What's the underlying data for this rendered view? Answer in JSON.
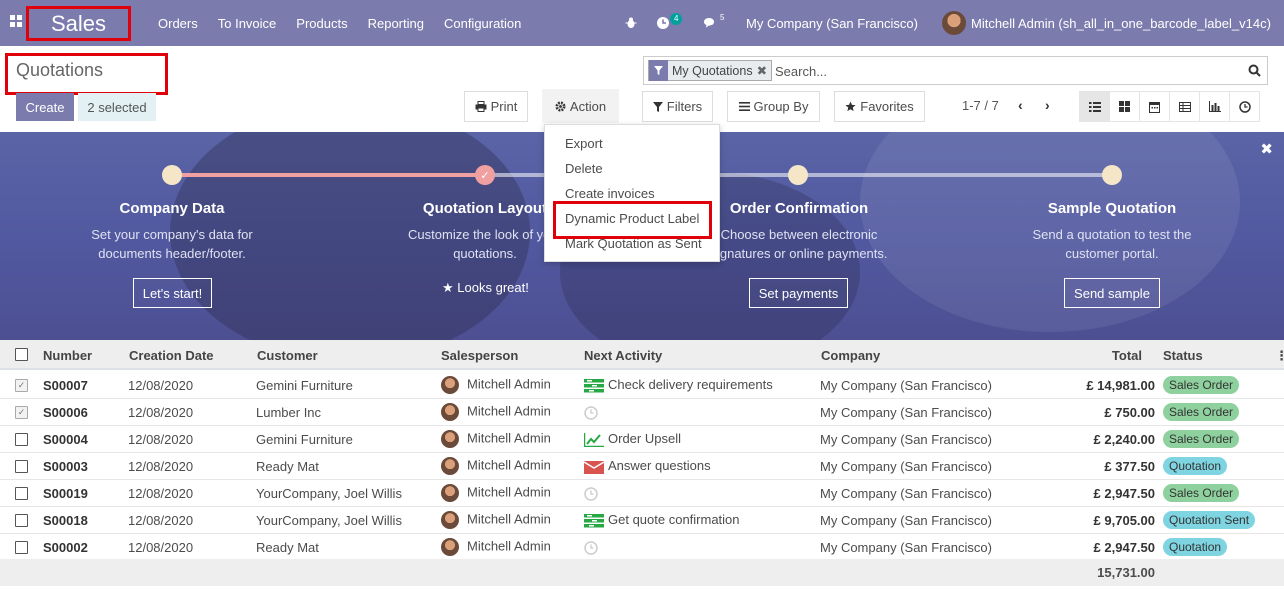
{
  "navbar": {
    "brand": "Sales",
    "menu": [
      "Orders",
      "To Invoice",
      "Products",
      "Reporting",
      "Configuration"
    ],
    "activity_count": "4",
    "message_count": "5",
    "company": "My Company (San Francisco)",
    "user": "Mitchell Admin (sh_all_in_one_barcode_label_v14c)"
  },
  "control": {
    "breadcrumb": "Quotations",
    "create_label": "Create",
    "selected_label": "2 selected",
    "print_label": "Print",
    "action_label": "Action",
    "filters_label": "Filters",
    "groupby_label": "Group By",
    "favorites_label": "Favorites",
    "pager": "1-7 / 7",
    "search_facet": "My Quotations",
    "search_placeholder": "Search..."
  },
  "action_menu": {
    "items": [
      "Export",
      "Delete",
      "Create invoices",
      "Dynamic Product Label",
      "Mark Quotation as Sent"
    ]
  },
  "banner": {
    "steps": [
      {
        "title": "Company Data",
        "desc1": "Set your company's data for",
        "desc2": "documents header/footer.",
        "button": "Let's start!"
      },
      {
        "title": "Quotation Layout",
        "desc1": "Customize the look of your",
        "desc2": "quotations.",
        "button": "Looks great!"
      },
      {
        "title": "Order Confirmation",
        "desc1": "Choose between electronic",
        "desc2": "signatures or online payments.",
        "button": "Set payments"
      },
      {
        "title": "Sample Quotation",
        "desc1": "Send a quotation to test the",
        "desc2": "customer portal.",
        "button": "Send sample"
      }
    ]
  },
  "table": {
    "columns": [
      "Number",
      "Creation Date",
      "Customer",
      "Salesperson",
      "Next Activity",
      "Company",
      "Total",
      "Status"
    ],
    "rows": [
      {
        "number": "S00007",
        "date": "12/08/2020",
        "customer": "Gemini Furniture",
        "salesperson": "Mitchell Admin",
        "activity": "Check delivery requirements",
        "activity_icon": "task-icon",
        "company": "My Company (San Francisco)",
        "total": "£ 14,981.00",
        "status": "Sales Order",
        "status_kind": "so",
        "checked": true
      },
      {
        "number": "S00006",
        "date": "12/08/2020",
        "customer": "Lumber Inc",
        "salesperson": "Mitchell Admin",
        "activity": "",
        "activity_icon": "clock-icon",
        "company": "My Company (San Francisco)",
        "total": "£ 750.00",
        "status": "Sales Order",
        "status_kind": "so",
        "checked": true
      },
      {
        "number": "S00004",
        "date": "12/08/2020",
        "customer": "Gemini Furniture",
        "salesperson": "Mitchell Admin",
        "activity": "Order Upsell",
        "activity_icon": "chart-icon",
        "company": "My Company (San Francisco)",
        "total": "£ 2,240.00",
        "status": "Sales Order",
        "status_kind": "so",
        "checked": false
      },
      {
        "number": "S00003",
        "date": "12/08/2020",
        "customer": "Ready Mat",
        "salesperson": "Mitchell Admin",
        "activity": "Answer questions",
        "activity_icon": "envelope-icon",
        "company": "My Company (San Francisco)",
        "total": "£ 377.50",
        "status": "Quotation",
        "status_kind": "q",
        "checked": false
      },
      {
        "number": "S00019",
        "date": "12/08/2020",
        "customer": "YourCompany, Joel Willis",
        "salesperson": "Mitchell Admin",
        "activity": "",
        "activity_icon": "clock-icon",
        "company": "My Company (San Francisco)",
        "total": "£ 2,947.50",
        "status": "Sales Order",
        "status_kind": "so",
        "checked": false
      },
      {
        "number": "S00018",
        "date": "12/08/2020",
        "customer": "YourCompany, Joel Willis",
        "salesperson": "Mitchell Admin",
        "activity": "Get quote confirmation",
        "activity_icon": "task-icon",
        "company": "My Company (San Francisco)",
        "total": "£ 9,705.00",
        "status": "Quotation Sent",
        "status_kind": "q",
        "checked": false
      },
      {
        "number": "S00002",
        "date": "12/08/2020",
        "customer": "Ready Mat",
        "salesperson": "Mitchell Admin",
        "activity": "",
        "activity_icon": "clock-icon",
        "company": "My Company (San Francisco)",
        "total": "£ 2,947.50",
        "status": "Quotation",
        "status_kind": "q",
        "checked": false
      }
    ],
    "grand_total": "15,731.00"
  }
}
